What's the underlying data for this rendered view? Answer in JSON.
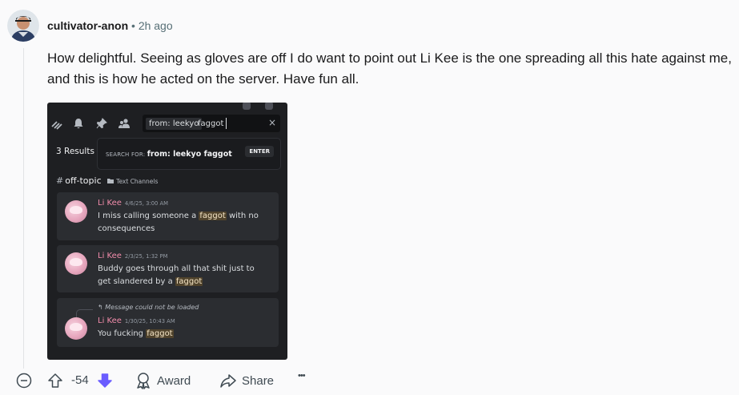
{
  "comment": {
    "username": "cultivator-anon",
    "separator": "•",
    "time": "2h ago",
    "body": "How delightful. Seeing as gloves are off I do want to point out Li Kee is the one spreading all this hate against me, and this is how he acted on the server. Have fun all."
  },
  "screenshot": {
    "search": {
      "filter_chip": "from: leekyo",
      "term": "faggot",
      "clear": "×"
    },
    "results_count": "3 Results",
    "popup": {
      "label": "SEARCH FOR:",
      "query": "from: leekyo faggot",
      "enter": "ENTER"
    },
    "channel": {
      "hash": "#",
      "name": "off-topic",
      "category": "Text Channels"
    },
    "messages": [
      {
        "author": "Li Kee",
        "timestamp": "4/6/25, 3:00 AM",
        "before": "I miss calling someone a ",
        "highlight": "faggot",
        "after": " with no consequences"
      },
      {
        "author": "Li Kee",
        "timestamp": "2/3/25, 1:32 PM",
        "before": "Buddy goes through all that shit just to get slandered by a ",
        "highlight": "faggot",
        "after": ""
      },
      {
        "author": "Li Kee",
        "timestamp": "1/30/25, 10:43 AM",
        "reply_note": "Message could not be loaded",
        "before": "You fucking ",
        "highlight": "faggot",
        "after": ""
      }
    ]
  },
  "actions": {
    "vote_count": "-54",
    "award_label": "Award",
    "share_label": "Share",
    "more_label": "•••"
  },
  "colors": {
    "downvote_active": "#6a5cff",
    "discord_bg": "#1e1f22",
    "highlight": "#50432c"
  }
}
